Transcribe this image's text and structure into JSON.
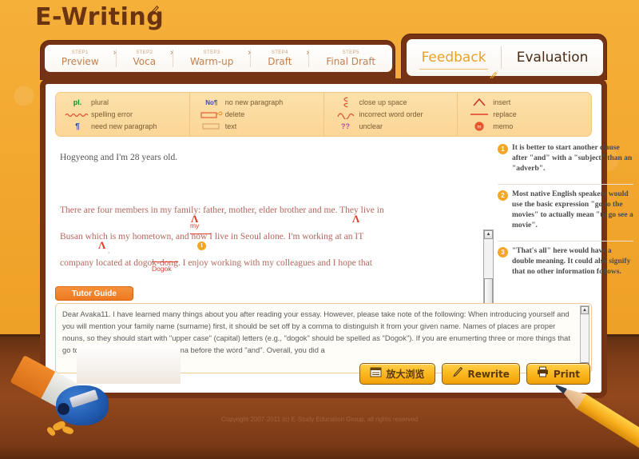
{
  "app": {
    "title": "E-Writing",
    "title_icon": "pencil-icon"
  },
  "steps": [
    {
      "num": "STEP1",
      "label": "Preview"
    },
    {
      "num": "STEP2",
      "label": "Voca"
    },
    {
      "num": "STEP3",
      "label": "Warm-up"
    },
    {
      "num": "STEP4",
      "label": "Draft"
    },
    {
      "num": "STEP5",
      "label": "Final Draft"
    }
  ],
  "tabs": [
    {
      "label": "Feedback",
      "active": true,
      "icon": "pencil-icon"
    },
    {
      "label": "Evaluation",
      "active": false
    }
  ],
  "legend": {
    "columns": [
      {
        "rows": [
          {
            "symbol": "pl.",
            "symbol_name": "plural-mark",
            "text": "plural"
          },
          {
            "symbol": "wavy-line",
            "symbol_name": "spelling-error-mark",
            "text": "spelling error"
          },
          {
            "symbol": "pilcrow",
            "symbol_name": "new-paragraph-mark",
            "text": "need new paragraph"
          }
        ]
      },
      {
        "rows": [
          {
            "symbol": "No¶",
            "symbol_name": "no-new-paragraph-mark",
            "text": "no new paragraph"
          },
          {
            "symbol": "delete-box",
            "symbol_name": "delete-mark",
            "text": "delete"
          },
          {
            "symbol": "text-box",
            "symbol_name": "text-mark",
            "text": "text"
          }
        ]
      },
      {
        "rows": [
          {
            "symbol": "close-up",
            "symbol_name": "close-up-space-mark",
            "text": "close up space"
          },
          {
            "symbol": "transpose",
            "symbol_name": "incorrect-word-order-mark",
            "text": "incorrect word order"
          },
          {
            "symbol": "??",
            "symbol_name": "unclear-mark",
            "text": "unclear"
          }
        ]
      },
      {
        "rows": [
          {
            "symbol": "caret",
            "symbol_name": "insert-mark",
            "text": "insert"
          },
          {
            "symbol": "line",
            "symbol_name": "replace-mark",
            "text": "replace"
          },
          {
            "symbol": "dot",
            "symbol_name": "memo-mark",
            "text": "memo"
          }
        ]
      }
    ]
  },
  "essay": {
    "lines": [
      "Hogyeong and I'm 28 years old.",
      "",
      "There are four members in my family: father, mother, elder brother and me. They live in",
      "Busan which is my hometown, and now I live in Seoul alone. I'm working at an IT",
      "company located at dogok-dong. I enjoy working with my colleagues and I hope that"
    ],
    "annotations": {
      "insert_word": "my",
      "correction_word": "Dogok",
      "memo_marker": "1"
    }
  },
  "notes": [
    {
      "marker": "1",
      "text": "It is better to start another clause after \"and\" with a \"subject\" than an \"adverb\"."
    },
    {
      "marker": "2",
      "text": "Most native English speakers would use the basic expression \"go to the movies\" to actually mean \"to go see a movie\"."
    },
    {
      "marker": "3",
      "text": "\"That's all\" here would have a double meaning. It could also signify that no other information follows."
    }
  ],
  "tutor_guide": {
    "tab_label": "Tutor Guide",
    "text": "Dear Avaka11. I have learned many things about you after reading your essay. However, please take note of the following: When introducing yourself and you will mention your family name (surname) first, it should be set off by a comma to distinguish it from your given name. Names of places are proper nouns, so they should start with \"upper case\" (capital) letters (e.g., \"dogok\" should be spelled as \"Dogok\"). If you are enumerting three or more things that go together, there should be a comma before the word \"and\". Overall, you did a"
  },
  "actions": [
    {
      "label": "放大浏览",
      "icon": "window-icon",
      "name": "enlarge-view-button"
    },
    {
      "label": "Rewrite",
      "icon": "pencil-icon",
      "name": "rewrite-button"
    },
    {
      "label": "Print",
      "icon": "printer-icon",
      "name": "print-button"
    }
  ],
  "footer": {
    "copyright": "Copyright 2007-2011 (c) E-Study Education Group, all rights reserved"
  },
  "scrollbars": {
    "up_arrow": "▲",
    "down_arrow": "▼"
  },
  "colors": {
    "brand_orange": "#f0a830",
    "frame_brown": "#733314",
    "desk_brown": "#93481d",
    "accent_gold": "#e8a226",
    "mark_red": "#e03c2a",
    "memo_orange": "#f5a623"
  }
}
